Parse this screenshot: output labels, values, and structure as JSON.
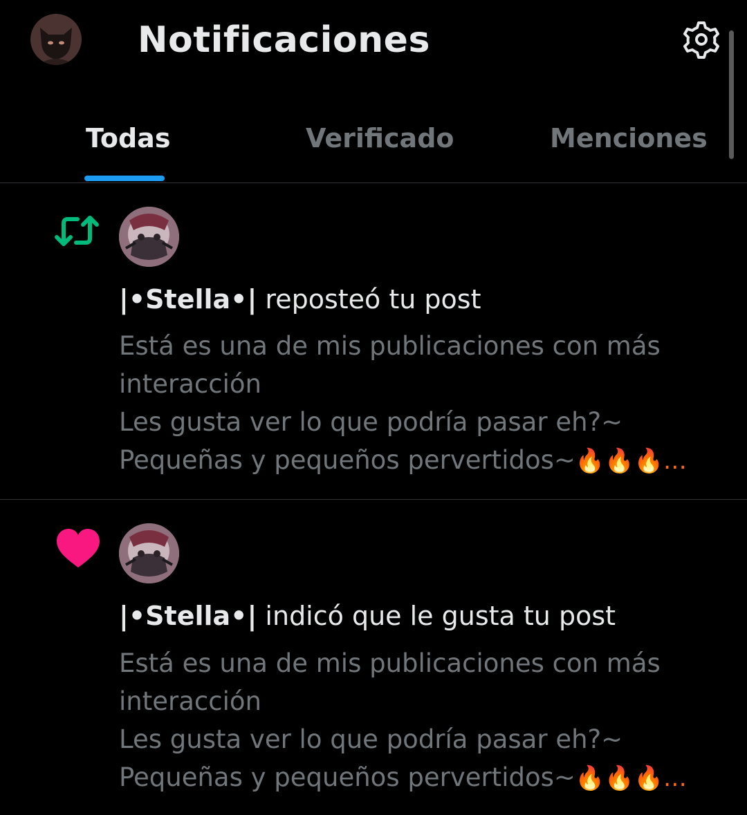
{
  "header": {
    "title": "Notificaciones",
    "avatar_icon": "user-avatar",
    "settings_icon": "gear-icon"
  },
  "tabs": [
    {
      "label": "Todas",
      "active": true
    },
    {
      "label": "Verificado",
      "active": false
    },
    {
      "label": "Menciones",
      "active": false
    }
  ],
  "accent_color": "#1d9bf0",
  "notifications": [
    {
      "type": "repost",
      "type_icon": "repost-icon",
      "icon_color": "#00ba7c",
      "user": "|•Stella•|",
      "action": " reposteó tu post",
      "preview_lines": [
        "Está es una de mis publicaciones con más",
        "interacción",
        "Les gusta ver lo que podría pasar eh?~",
        "Pequeñas y pequeños pervertidos~"
      ],
      "preview_tail": "🔥🔥🔥…"
    },
    {
      "type": "like",
      "type_icon": "heart-icon",
      "icon_color": "#f91880",
      "user": "|•Stella•|",
      "action": " indicó que le gusta tu post",
      "preview_lines": [
        "Está es una de mis publicaciones con más",
        "interacción",
        "Les gusta ver lo que podría pasar eh?~",
        "Pequeñas y pequeños pervertidos~"
      ],
      "preview_tail": "🔥🔥🔥…"
    }
  ]
}
